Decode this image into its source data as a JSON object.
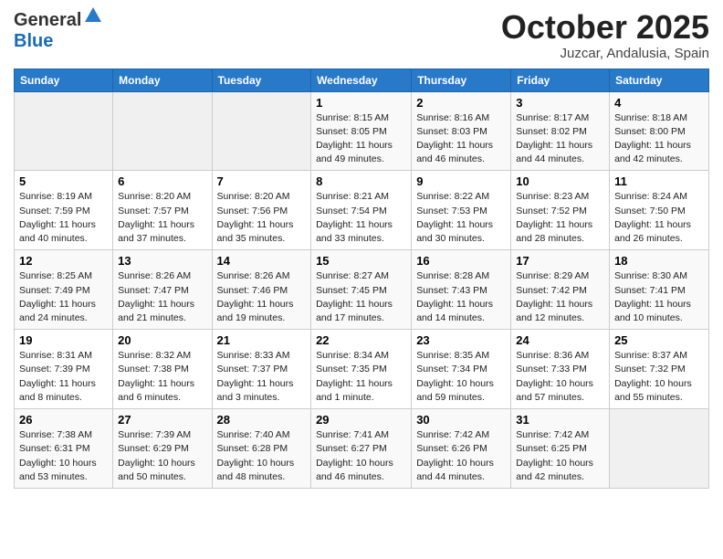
{
  "header": {
    "logo_general": "General",
    "logo_blue": "Blue",
    "month_title": "October 2025",
    "location": "Juzcar, Andalusia, Spain"
  },
  "weekdays": [
    "Sunday",
    "Monday",
    "Tuesday",
    "Wednesday",
    "Thursday",
    "Friday",
    "Saturday"
  ],
  "weeks": [
    [
      {
        "day": "",
        "info": ""
      },
      {
        "day": "",
        "info": ""
      },
      {
        "day": "",
        "info": ""
      },
      {
        "day": "1",
        "info": "Sunrise: 8:15 AM\nSunset: 8:05 PM\nDaylight: 11 hours and 49 minutes."
      },
      {
        "day": "2",
        "info": "Sunrise: 8:16 AM\nSunset: 8:03 PM\nDaylight: 11 hours and 46 minutes."
      },
      {
        "day": "3",
        "info": "Sunrise: 8:17 AM\nSunset: 8:02 PM\nDaylight: 11 hours and 44 minutes."
      },
      {
        "day": "4",
        "info": "Sunrise: 8:18 AM\nSunset: 8:00 PM\nDaylight: 11 hours and 42 minutes."
      }
    ],
    [
      {
        "day": "5",
        "info": "Sunrise: 8:19 AM\nSunset: 7:59 PM\nDaylight: 11 hours and 40 minutes."
      },
      {
        "day": "6",
        "info": "Sunrise: 8:20 AM\nSunset: 7:57 PM\nDaylight: 11 hours and 37 minutes."
      },
      {
        "day": "7",
        "info": "Sunrise: 8:20 AM\nSunset: 7:56 PM\nDaylight: 11 hours and 35 minutes."
      },
      {
        "day": "8",
        "info": "Sunrise: 8:21 AM\nSunset: 7:54 PM\nDaylight: 11 hours and 33 minutes."
      },
      {
        "day": "9",
        "info": "Sunrise: 8:22 AM\nSunset: 7:53 PM\nDaylight: 11 hours and 30 minutes."
      },
      {
        "day": "10",
        "info": "Sunrise: 8:23 AM\nSunset: 7:52 PM\nDaylight: 11 hours and 28 minutes."
      },
      {
        "day": "11",
        "info": "Sunrise: 8:24 AM\nSunset: 7:50 PM\nDaylight: 11 hours and 26 minutes."
      }
    ],
    [
      {
        "day": "12",
        "info": "Sunrise: 8:25 AM\nSunset: 7:49 PM\nDaylight: 11 hours and 24 minutes."
      },
      {
        "day": "13",
        "info": "Sunrise: 8:26 AM\nSunset: 7:47 PM\nDaylight: 11 hours and 21 minutes."
      },
      {
        "day": "14",
        "info": "Sunrise: 8:26 AM\nSunset: 7:46 PM\nDaylight: 11 hours and 19 minutes."
      },
      {
        "day": "15",
        "info": "Sunrise: 8:27 AM\nSunset: 7:45 PM\nDaylight: 11 hours and 17 minutes."
      },
      {
        "day": "16",
        "info": "Sunrise: 8:28 AM\nSunset: 7:43 PM\nDaylight: 11 hours and 14 minutes."
      },
      {
        "day": "17",
        "info": "Sunrise: 8:29 AM\nSunset: 7:42 PM\nDaylight: 11 hours and 12 minutes."
      },
      {
        "day": "18",
        "info": "Sunrise: 8:30 AM\nSunset: 7:41 PM\nDaylight: 11 hours and 10 minutes."
      }
    ],
    [
      {
        "day": "19",
        "info": "Sunrise: 8:31 AM\nSunset: 7:39 PM\nDaylight: 11 hours and 8 minutes."
      },
      {
        "day": "20",
        "info": "Sunrise: 8:32 AM\nSunset: 7:38 PM\nDaylight: 11 hours and 6 minutes."
      },
      {
        "day": "21",
        "info": "Sunrise: 8:33 AM\nSunset: 7:37 PM\nDaylight: 11 hours and 3 minutes."
      },
      {
        "day": "22",
        "info": "Sunrise: 8:34 AM\nSunset: 7:35 PM\nDaylight: 11 hours and 1 minute."
      },
      {
        "day": "23",
        "info": "Sunrise: 8:35 AM\nSunset: 7:34 PM\nDaylight: 10 hours and 59 minutes."
      },
      {
        "day": "24",
        "info": "Sunrise: 8:36 AM\nSunset: 7:33 PM\nDaylight: 10 hours and 57 minutes."
      },
      {
        "day": "25",
        "info": "Sunrise: 8:37 AM\nSunset: 7:32 PM\nDaylight: 10 hours and 55 minutes."
      }
    ],
    [
      {
        "day": "26",
        "info": "Sunrise: 7:38 AM\nSunset: 6:31 PM\nDaylight: 10 hours and 53 minutes."
      },
      {
        "day": "27",
        "info": "Sunrise: 7:39 AM\nSunset: 6:29 PM\nDaylight: 10 hours and 50 minutes."
      },
      {
        "day": "28",
        "info": "Sunrise: 7:40 AM\nSunset: 6:28 PM\nDaylight: 10 hours and 48 minutes."
      },
      {
        "day": "29",
        "info": "Sunrise: 7:41 AM\nSunset: 6:27 PM\nDaylight: 10 hours and 46 minutes."
      },
      {
        "day": "30",
        "info": "Sunrise: 7:42 AM\nSunset: 6:26 PM\nDaylight: 10 hours and 44 minutes."
      },
      {
        "day": "31",
        "info": "Sunrise: 7:42 AM\nSunset: 6:25 PM\nDaylight: 10 hours and 42 minutes."
      },
      {
        "day": "",
        "info": ""
      }
    ]
  ]
}
